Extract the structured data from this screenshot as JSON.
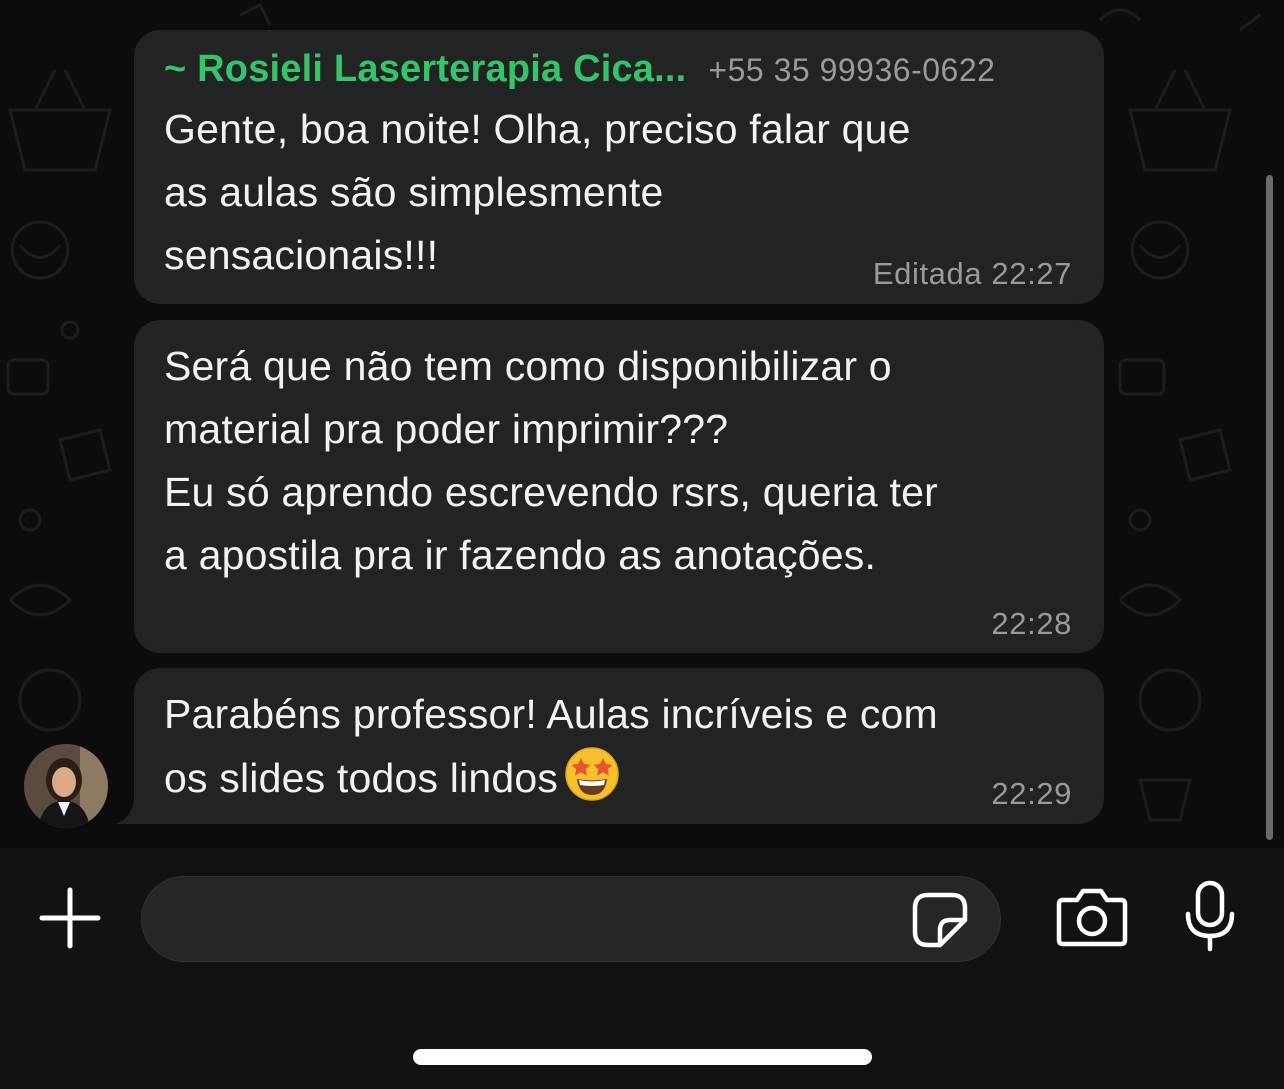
{
  "messages": [
    {
      "sender_name": "~ Rosieli Laserterapia Cica...",
      "sender_phone": "+55 35 99936-0622",
      "text": "Gente, boa noite! Olha, preciso falar que\nas aulas são simplesmente\nsensacionais!!!",
      "edited_label": "Editada",
      "time": "22:27"
    },
    {
      "text": "Será que não tem como disponibilizar o\nmaterial pra poder imprimir???\nEu só aprendo escrevendo rsrs, queria ter\na apostila pra ir fazendo as anotações.",
      "time": "22:28"
    },
    {
      "text": "Parabéns professor! Aulas incríveis e com\nos slides todos lindos",
      "emoji": "star-struck-emoji",
      "time": "22:29"
    }
  ],
  "composer": {
    "placeholder": "",
    "icons": [
      "plus-icon",
      "sticker-icon",
      "camera-icon",
      "microphone-icon"
    ]
  },
  "colors": {
    "background": "#0c0c0c",
    "bubble": "#222323",
    "sender_name": "#35c46a",
    "meta_text": "#9a9a9a"
  }
}
